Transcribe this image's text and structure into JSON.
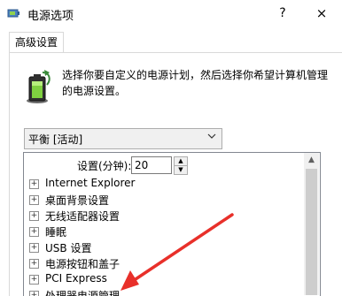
{
  "window": {
    "title": "电源选项",
    "help_symbol": "?",
    "close_symbol": "×"
  },
  "tabs": [
    {
      "label": "高级设置"
    }
  ],
  "description": "选择你要自定义的电源计划，然后选择你希望计算机管理的电源设置。",
  "plan_dropdown": {
    "value": "平衡 [活动]"
  },
  "setting": {
    "label": "设置(分钟):",
    "value": "20"
  },
  "tree": {
    "expander_symbol": "+",
    "items": [
      {
        "label": "Internet Explorer"
      },
      {
        "label": "桌面背景设置"
      },
      {
        "label": "无线适配器设置"
      },
      {
        "label": "睡眠"
      },
      {
        "label": "USB 设置"
      },
      {
        "label": "电源按钮和盖子"
      },
      {
        "label": "PCI Express"
      },
      {
        "label": "处理器电源管理"
      }
    ]
  },
  "colors": {
    "annotation_arrow": "#e8302a"
  }
}
